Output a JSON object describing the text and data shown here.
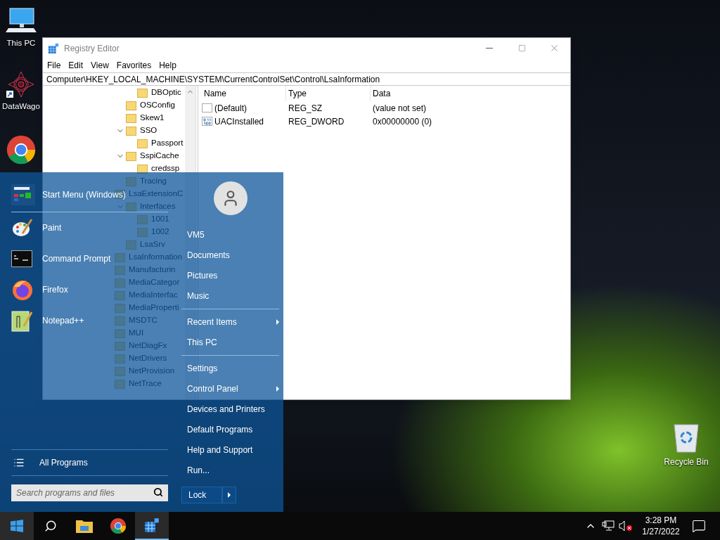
{
  "desktop_icons": [
    {
      "kind": "computer",
      "label": "This PC"
    },
    {
      "kind": "shortcut",
      "label": "DataWago"
    },
    {
      "kind": "browser"
    }
  ],
  "recycle_bin": {
    "label": "Recycle Bin"
  },
  "registry_editor": {
    "title": "Registry Editor",
    "menu": [
      "File",
      "Edit",
      "View",
      "Favorites",
      "Help"
    ],
    "address": "Computer\\HKEY_LOCAL_MACHINE\\SYSTEM\\CurrentControlSet\\Control\\LsaInformation",
    "tree": [
      {
        "children": [
          {
            "children": [
              {
                "label": "DBOptic"
              }
            ]
          },
          {
            "label": "OSConfig"
          },
          {
            "label": "Skew1"
          },
          {
            "label": "SSO",
            "expanded": true,
            "children": [
              {
                "label": "Passport"
              }
            ]
          },
          {
            "label": "SspiCache",
            "expanded": true,
            "children": [
              {
                "label": "credssp"
              }
            ]
          },
          {
            "label": "Tracing"
          }
        ]
      },
      {
        "label": "LsaExtensionC",
        "expanded": true,
        "children": [
          {
            "label": "Interfaces",
            "expanded": true,
            "children": [
              {
                "label": "1001"
              },
              {
                "label": "1002"
              }
            ]
          },
          {
            "label": "LsaSrv"
          }
        ]
      },
      {
        "label": "LsaInformation"
      },
      {
        "label": "Manufacturin"
      },
      {
        "label": "MediaCategor"
      },
      {
        "label": "MediaInterfac"
      },
      {
        "label": "MediaProperti"
      },
      {
        "label": "MSDTC"
      },
      {
        "label": "MUI"
      },
      {
        "label": "NetDiagFx"
      },
      {
        "label": "NetDrivers"
      },
      {
        "label": "NetProvision"
      },
      {
        "label": "NetTrace"
      }
    ],
    "columns": [
      "Name",
      "Type",
      "Data"
    ],
    "values": [
      {
        "kind": "string",
        "name": "(Default)",
        "type": "REG_SZ",
        "data": "(value not set)"
      },
      {
        "kind": "dword",
        "name": "UACInstalled",
        "type": "REG_DWORD",
        "data": "0x00000000 (0)"
      }
    ]
  },
  "start_menu": {
    "header": "Start Menu (Windows)",
    "pinned": [
      {
        "kind": "paint",
        "label": "Paint"
      },
      {
        "kind": "console",
        "label": "Command Prompt"
      },
      {
        "kind": "firefox",
        "label": "Firefox"
      },
      {
        "kind": "notepad",
        "label": "Notepad++"
      }
    ],
    "all_programs": "All Programs",
    "search": {
      "placeholder": "Search programs and files"
    },
    "user_links": [
      [
        {
          "label": "VM5",
          "submenu": false
        },
        {
          "label": "Documents",
          "submenu": false
        },
        {
          "label": "Pictures",
          "submenu": false
        },
        {
          "label": "Music",
          "submenu": false
        }
      ],
      [
        {
          "label": "Recent Items",
          "submenu": true
        },
        {
          "label": "This PC",
          "submenu": false
        }
      ],
      [
        {
          "label": "Settings",
          "submenu": false
        },
        {
          "label": "Control Panel",
          "submenu": true
        },
        {
          "label": "Devices and Printers",
          "submenu": false
        },
        {
          "label": "Default Programs",
          "submenu": false
        },
        {
          "label": "Help and Support",
          "submenu": false
        },
        {
          "label": "Run...",
          "submenu": false
        }
      ]
    ],
    "power_button": "Lock"
  },
  "taskbar": {
    "buttons": [
      {
        "kind": "start",
        "selected": true,
        "running": false
      },
      {
        "kind": "search",
        "selected": false,
        "running": false
      },
      {
        "kind": "explorer",
        "selected": false,
        "running": false
      },
      {
        "kind": "chrome",
        "selected": false,
        "running": false
      },
      {
        "kind": "regedit",
        "selected": true,
        "running": true
      }
    ],
    "volume_muted": true,
    "time": "3:28 PM",
    "date": "1/27/2022"
  }
}
